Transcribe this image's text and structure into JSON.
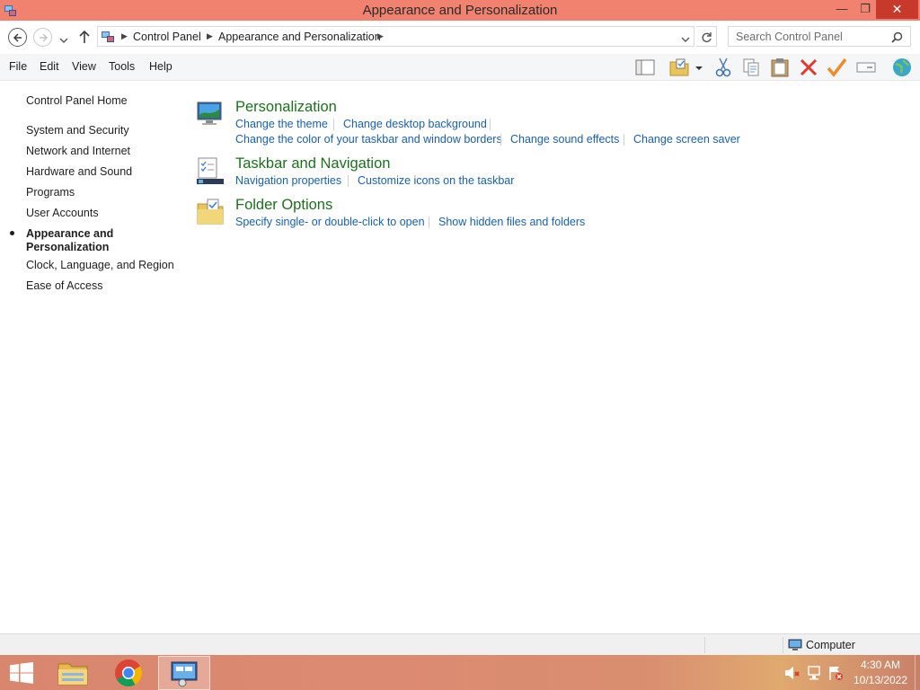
{
  "window": {
    "title": "Appearance and Personalization",
    "minimize_glyph": "—",
    "maximize_glyph": "❐",
    "close_glyph": "✕"
  },
  "address": {
    "crumbs": [
      "Control Panel",
      "Appearance and Personalization"
    ],
    "search_placeholder": "Search Control Panel"
  },
  "menu": [
    "File",
    "Edit",
    "View",
    "Tools",
    "Help"
  ],
  "toolbar_icons": [
    "layout-pane-icon",
    "folder-checkbox-icon",
    "cut-icon",
    "copy-icon",
    "paste-icon",
    "delete-icon",
    "checkmark-icon",
    "rename-icon",
    "globe-icon"
  ],
  "leftnav": {
    "home": "Control Panel Home",
    "items": [
      "System and Security",
      "Network and Internet",
      "Hardware and Sound",
      "Programs",
      "User Accounts",
      "Appearance and",
      "Personalization",
      "Clock, Language, and Region",
      "Ease of Access"
    ]
  },
  "categories": [
    {
      "title": "Personalization",
      "icon": "personalization-icon",
      "tasks": [
        "Change the theme",
        "Change desktop background",
        "Change the color of your taskbar and window borders",
        "Change sound effects",
        "Change screen saver"
      ]
    },
    {
      "title": "Taskbar and Navigation",
      "icon": "taskbar-icon",
      "tasks": [
        "Navigation properties",
        "Customize icons on the taskbar"
      ]
    },
    {
      "title": "Folder Options",
      "icon": "folder-options-icon",
      "tasks": [
        "Specify single- or double-click to open",
        "Show hidden files and folders"
      ]
    }
  ],
  "status": {
    "computer": "Computer"
  },
  "taskbar": {
    "apps": [
      "file-explorer-icon",
      "chrome-icon",
      "control-panel-icon"
    ],
    "active_app": "control-panel-icon",
    "time": "4:30 AM",
    "date": "10/13/2022"
  },
  "colors": {
    "titlebar": "#f0826f",
    "close": "#c7392b",
    "link": "#1a5fa8",
    "category_title": "#1e6e1e"
  }
}
